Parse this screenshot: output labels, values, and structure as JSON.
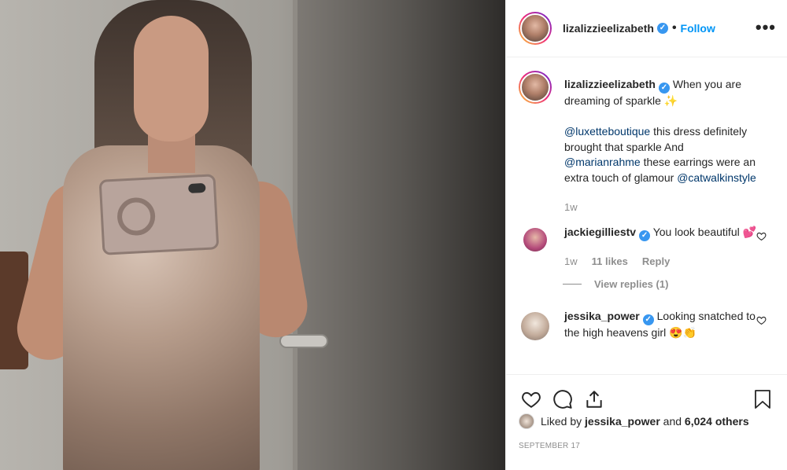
{
  "post": {
    "author": "lizalizzieelizabeth",
    "follow_label": "Follow",
    "separator": "•",
    "more_label": "•••",
    "caption": {
      "lead": "When you are dreaming of sparkle",
      "sparkle": "✨",
      "mention1": "@luxetteboutique",
      "line2": "this dress definitely brought that sparkle And",
      "mention2": "@marianrahme",
      "line3": "these earrings were an extra touch of glamour",
      "mention3": "@catwalkinstyle"
    },
    "caption_time": "1w"
  },
  "comments": [
    {
      "user": "jackiegilliestv",
      "text": "You look beautiful",
      "emoji": "💕",
      "time": "1w",
      "likes": "11 likes",
      "reply": "Reply",
      "view_replies": "View replies (1)"
    },
    {
      "user": "jessika_power",
      "text": "Looking snatched to the high heavens girl",
      "emoji": "😍👏"
    }
  ],
  "likes_line": {
    "prefix": "Liked by",
    "user": "jessika_power",
    "and": "and",
    "count": "6,024 others"
  },
  "date": "SEPTEMBER 17",
  "icons": {
    "like": "heart-icon",
    "comment": "comment-icon",
    "share": "share-icon",
    "save": "bookmark-icon"
  }
}
